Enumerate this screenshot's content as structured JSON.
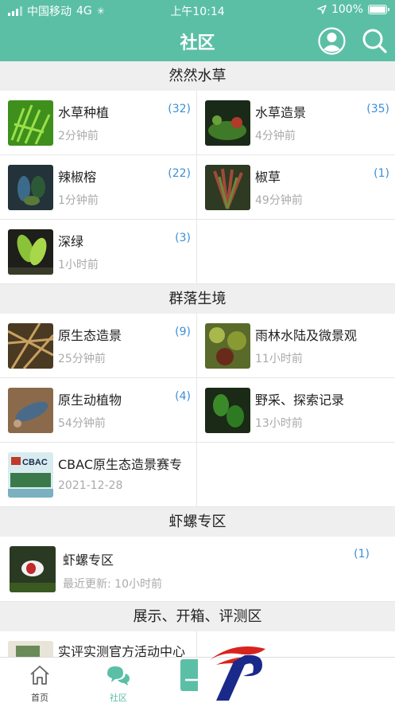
{
  "status_bar": {
    "carrier": "中国移动",
    "network": "4G",
    "time": "上午10:14",
    "battery": "100%"
  },
  "nav": {
    "title": "社区"
  },
  "sections": [
    {
      "title": "然然水草",
      "items": [
        {
          "title": "水草种植",
          "count": "(32)",
          "time": "2分钟前"
        },
        {
          "title": "水草造景",
          "count": "(35)",
          "time": "4分钟前"
        },
        {
          "title": "辣椒榕",
          "count": "(22)",
          "time": "1分钟前"
        },
        {
          "title": "椒草",
          "count": "(1)",
          "time": "49分钟前"
        },
        {
          "title": "深绿",
          "count": "(3)",
          "time": "1小时前"
        }
      ]
    },
    {
      "title": "群落生境",
      "items": [
        {
          "title": "原生态造景",
          "count": "(9)",
          "time": "25分钟前"
        },
        {
          "title": "雨林水陆及微景观",
          "count": "",
          "time": "11小时前"
        },
        {
          "title": "原生动植物",
          "count": "(4)",
          "time": "54分钟前"
        },
        {
          "title": "野采、探索记录",
          "count": "",
          "time": "13小时前"
        },
        {
          "title": "CBAC原生态造景赛专",
          "count": "",
          "time": "2021-12-28",
          "thumb_text": "CBAC"
        }
      ]
    },
    {
      "title": "虾螺专区",
      "items": [
        {
          "title": "虾螺专区",
          "count": "(1)",
          "time": "最近更新: 10小时前"
        }
      ]
    },
    {
      "title": "展示、开箱、评测区",
      "items": [
        {
          "title": "实评实测官方活动中心",
          "count": "",
          "time": ""
        }
      ]
    }
  ],
  "tabbar": {
    "home": "首页",
    "community": "社区"
  },
  "colors": {
    "brand": "#5bbfa6",
    "count": "#3b8fd6"
  },
  "icons": {
    "user": "user-icon",
    "search": "search-icon",
    "home": "home-icon",
    "community": "chat-bubbles-icon"
  }
}
